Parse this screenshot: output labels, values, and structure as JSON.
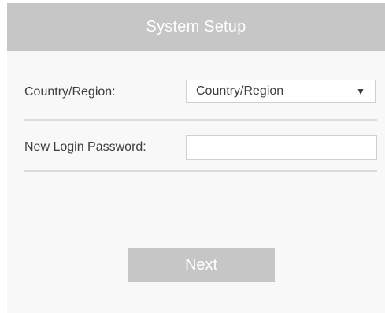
{
  "header": {
    "title": "System Setup"
  },
  "form": {
    "country": {
      "label": "Country/Region:",
      "selected_value": "Country/Region",
      "caret_icon": "caret-down-icon"
    },
    "password": {
      "label": "New Login Password:",
      "value": "",
      "placeholder": ""
    }
  },
  "actions": {
    "next_label": "Next"
  },
  "colors": {
    "header_bg": "#c6c6c6",
    "panel_bg": "#f8f8f8",
    "button_bg": "#c6c6c6",
    "divider": "#dcdcdc"
  }
}
